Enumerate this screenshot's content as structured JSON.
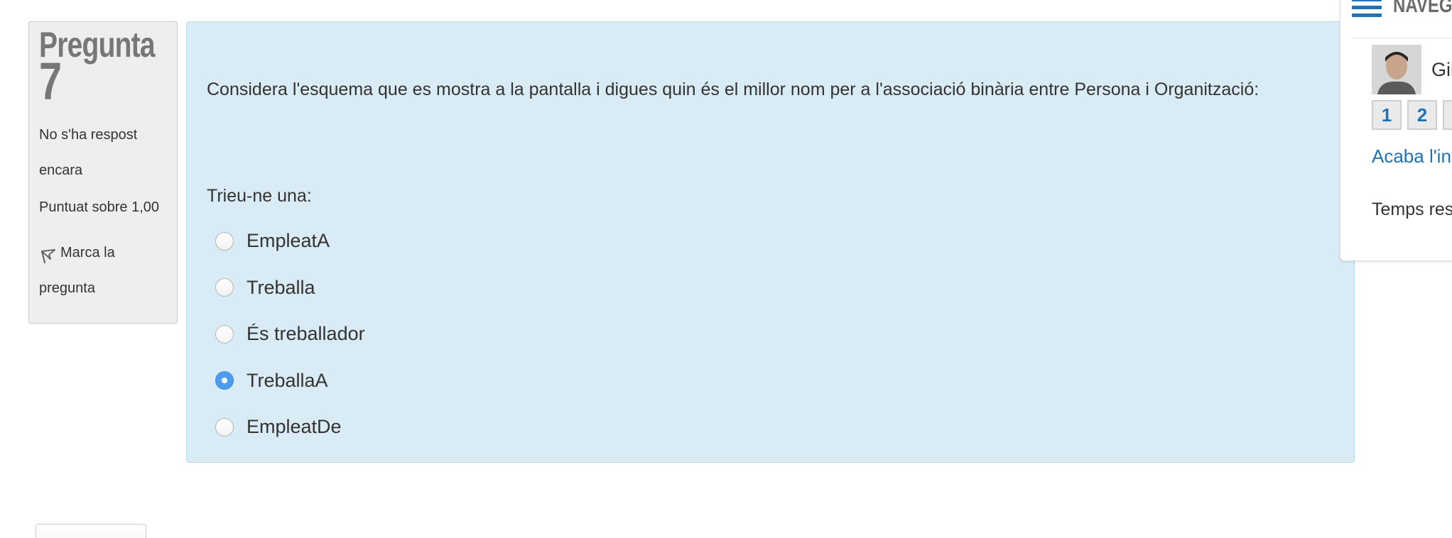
{
  "question_info": {
    "label": "Pregunta",
    "number": "7",
    "state": "No s'ha respost encara",
    "grade": "Puntuat sobre 1,00",
    "flag_label": "Marca la pregunta"
  },
  "question": {
    "text": "Considera l'esquema que es mostra a la pantalla i digues quin és el millor nom per a l'associació binària entre Persona i Organització:",
    "prompt": "Trieu-ne una:",
    "options": [
      {
        "label": "EmpleatA",
        "checked": false
      },
      {
        "label": "Treballa",
        "checked": false
      },
      {
        "label": "És treballador",
        "checked": false
      },
      {
        "label": "TreballaA",
        "checked": true
      },
      {
        "label": "EmpleatDe",
        "checked": false
      }
    ]
  },
  "navigation": {
    "title": "NAVEGA",
    "user_name": "Gil",
    "question_buttons": [
      "1",
      "2",
      ""
    ],
    "finish_link": "Acaba l'in",
    "timer_label": "Temps res"
  },
  "colors": {
    "formulation_bg": "#d9ebf4",
    "link": "#1f72b6",
    "radio_checked": "#4d9cf0"
  }
}
